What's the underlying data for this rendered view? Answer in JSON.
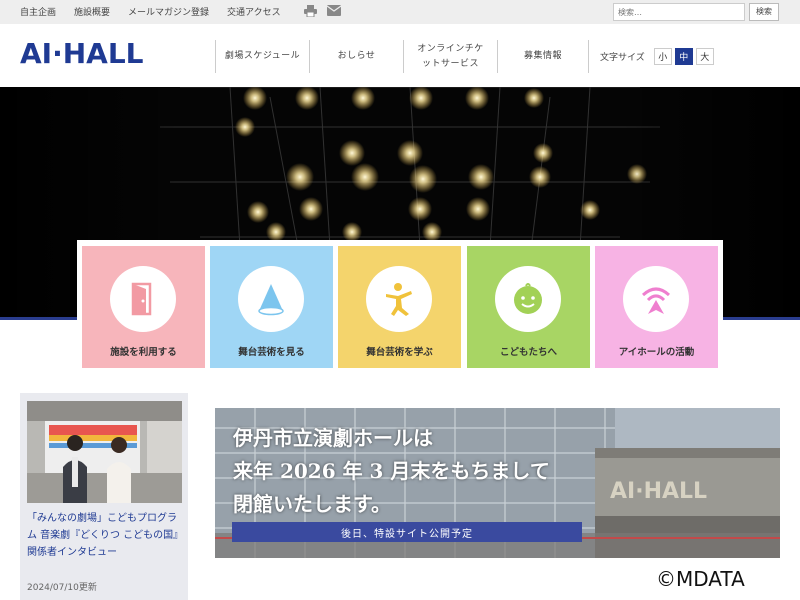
{
  "topbar": {
    "links": [
      "自主企画",
      "施設概要",
      "メールマガジン登録",
      "交通アクセス"
    ],
    "print_icon": "printer-icon",
    "mail_icon": "mail-icon",
    "search_placeholder": "検索…",
    "search_button": "検索"
  },
  "header": {
    "logo_text": "AI·HALL",
    "nav": [
      "劇場スケジュール",
      "おしらせ",
      "オンラインチケットサービス",
      "募集情報"
    ],
    "fontsize_label": "文字サイズ",
    "fontsize_options": [
      "小",
      "中",
      "大"
    ],
    "fontsize_selected": "中"
  },
  "tiles": [
    {
      "label": "施設を利用する",
      "color": "#f7b5bb",
      "icon": "door-icon"
    },
    {
      "label": "舞台芸術を見る",
      "color": "#9fd6f5",
      "icon": "spotlight-icon"
    },
    {
      "label": "舞台芸術を学ぶ",
      "color": "#f4d46c",
      "icon": "dancer-icon"
    },
    {
      "label": "こどもたちへ",
      "color": "#a8d564",
      "icon": "baby-face-icon"
    },
    {
      "label": "アイホールの活動",
      "color": "#f7b3e4",
      "icon": "broadcast-icon"
    }
  ],
  "news": {
    "title": "「みんなの劇場」こどもプログラム 音楽劇『どくりつ こどもの国』関係者インタビュー",
    "date": "2024/07/10更新"
  },
  "banner": {
    "line1": "伊丹市立演劇ホールは",
    "line2": "来年 2026 年 3 月末をもちまして",
    "line3": "閉館いたします。",
    "strip": "後日、特設サイト公開予定",
    "building_sign": "AI·HALL"
  },
  "copyright": "©MDATA",
  "colors": {
    "brand": "#1f3a93",
    "topbar": "#eeeeee"
  }
}
